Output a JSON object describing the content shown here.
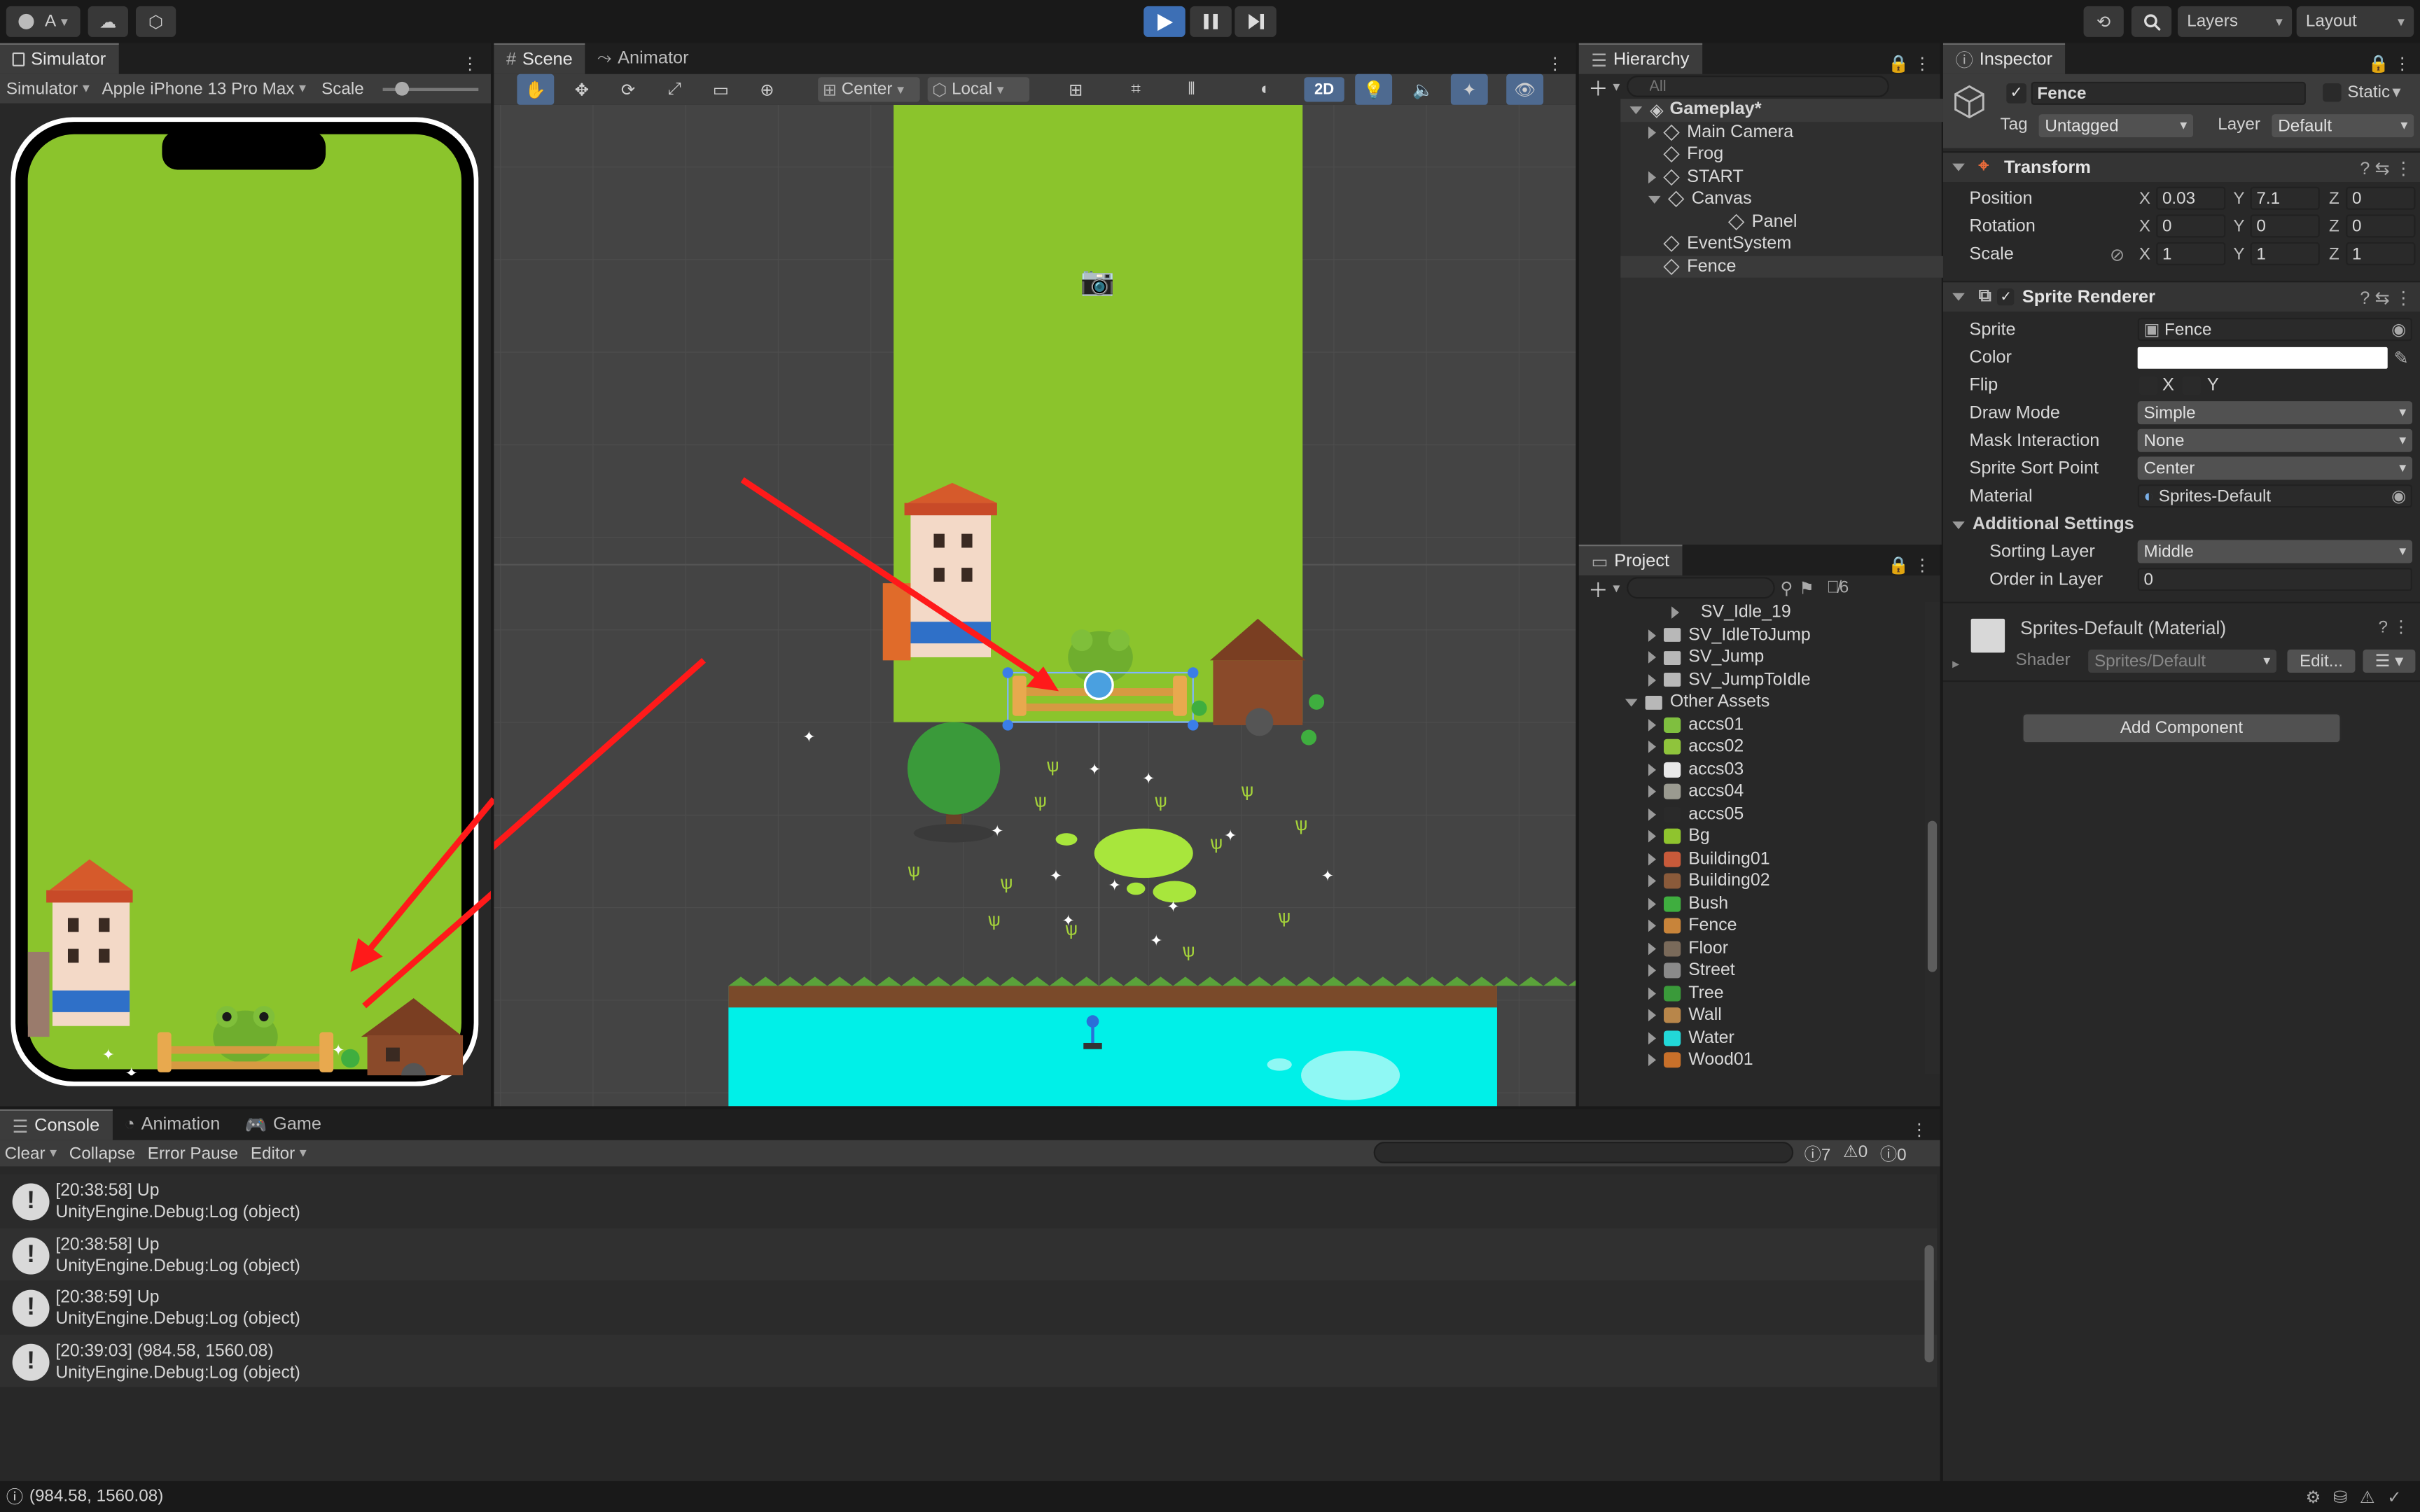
{
  "toolbar": {
    "account": "A",
    "history_icon": "history-icon",
    "search_icon": "search-icon",
    "layers_label": "Layers",
    "layout_label": "Layout"
  },
  "simulator": {
    "tab": "Simulator",
    "mode": "Simulator",
    "device": "Apple iPhone 13 Pro Max",
    "scale_label": "Scale"
  },
  "scene": {
    "tab_scene": "Scene",
    "tab_animator": "Animator",
    "pivot": "Center",
    "space": "Local",
    "mode_2d": "2D"
  },
  "hierarchy": {
    "tab": "Hierarchy",
    "search_placeholder": "All",
    "root": "Gameplay*",
    "items": [
      {
        "label": "Main Camera",
        "expandable": true
      },
      {
        "label": "Frog",
        "expandable": false
      },
      {
        "label": "START",
        "expandable": true
      },
      {
        "label": "Canvas",
        "expandable": true,
        "expanded": true
      },
      {
        "label": "Panel",
        "expandable": false,
        "child": true
      },
      {
        "label": "EventSystem",
        "expandable": false
      },
      {
        "label": "Fence",
        "expandable": false,
        "selected": true
      }
    ]
  },
  "project": {
    "tab": "Project",
    "hidden_count": "6",
    "items": [
      {
        "label": "SV_Idle_19",
        "indent": 2,
        "type": "file"
      },
      {
        "label": "SV_IdleToJump",
        "indent": 1,
        "type": "folder"
      },
      {
        "label": "SV_Jump",
        "indent": 1,
        "type": "folder"
      },
      {
        "label": "SV_JumpToIdle",
        "indent": 1,
        "type": "folder"
      },
      {
        "label": "Other Assets",
        "indent": 0,
        "type": "folder",
        "expanded": true
      },
      {
        "label": "accs01",
        "indent": 1,
        "color": "#7fbf3f"
      },
      {
        "label": "accs02",
        "indent": 1,
        "color": "#8fc43c"
      },
      {
        "label": "accs03",
        "indent": 1,
        "color": "#e8e8e8"
      },
      {
        "label": "accs04",
        "indent": 1,
        "color": "#9a9a90"
      },
      {
        "label": "accs05",
        "indent": 1,
        "color": "#2a2a2a"
      },
      {
        "label": "Bg",
        "indent": 1,
        "color": "#8fc42e"
      },
      {
        "label": "Building01",
        "indent": 1,
        "color": "#c85a3a"
      },
      {
        "label": "Building02",
        "indent": 1,
        "color": "#8a5a3a"
      },
      {
        "label": "Bush",
        "indent": 1,
        "color": "#3fae3f"
      },
      {
        "label": "Fence",
        "indent": 1,
        "color": "#c8843a"
      },
      {
        "label": "Floor",
        "indent": 1,
        "color": "#7a6a5a"
      },
      {
        "label": "Street",
        "indent": 1,
        "color": "#8a8a8a"
      },
      {
        "label": "Tree",
        "indent": 1,
        "color": "#3a9a3a"
      },
      {
        "label": "Wall",
        "indent": 1,
        "color": "#b8864a"
      },
      {
        "label": "Water",
        "indent": 1,
        "color": "#22d8d8"
      },
      {
        "label": "Wood01",
        "indent": 1,
        "color": "#c8702a"
      }
    ]
  },
  "inspector": {
    "tab": "Inspector",
    "object_name": "Fence",
    "static_label": "Static",
    "tag_label": "Tag",
    "tag_value": "Untagged",
    "layer_label": "Layer",
    "layer_value": "Default",
    "transform": {
      "title": "Transform",
      "position_label": "Position",
      "rotation_label": "Rotation",
      "scale_label": "Scale",
      "position": {
        "x": "0.03",
        "y": "7.1",
        "z": "0"
      },
      "rotation": {
        "x": "0",
        "y": "0",
        "z": "0"
      },
      "scale": {
        "x": "1",
        "y": "1",
        "z": "1"
      }
    },
    "sprite_renderer": {
      "title": "Sprite Renderer",
      "sprite_label": "Sprite",
      "sprite_value": "Fence",
      "color_label": "Color",
      "color_value": "#FFFFFF",
      "flip_label": "Flip",
      "flip_x": "X",
      "flip_y": "Y",
      "draw_mode_label": "Draw Mode",
      "draw_mode": "Simple",
      "mask_label": "Mask Interaction",
      "mask": "None",
      "sort_point_label": "Sprite Sort Point",
      "sort_point": "Center",
      "material_label": "Material",
      "material": "Sprites-Default",
      "additional": "Additional Settings",
      "sorting_layer_label": "Sorting Layer",
      "sorting_layer": "Middle",
      "order_label": "Order in Layer",
      "order": "0"
    },
    "material": {
      "name": "Sprites-Default (Material)",
      "shader_label": "Shader",
      "shader": "Sprites/Default",
      "edit": "Edit..."
    },
    "add_component": "Add Component"
  },
  "console": {
    "tab_console": "Console",
    "tab_animation": "Animation",
    "tab_game": "Game",
    "clear": "Clear",
    "collapse": "Collapse",
    "error_pause": "Error Pause",
    "editor": "Editor",
    "count_log": "7",
    "count_warn": "0",
    "count_err": "0",
    "entries": [
      {
        "line1": "[20:38:58] Up",
        "line2": "UnityEngine.Debug:Log (object)"
      },
      {
        "line1": "[20:38:58] Up",
        "line2": "UnityEngine.Debug:Log (object)"
      },
      {
        "line1": "[20:38:59] Up",
        "line2": "UnityEngine.Debug:Log (object)"
      },
      {
        "line1": "[20:39:03] (984.58, 1560.08)",
        "line2": "UnityEngine.Debug:Log (object)"
      }
    ]
  },
  "status": {
    "message": "(984.58, 1560.08)"
  }
}
